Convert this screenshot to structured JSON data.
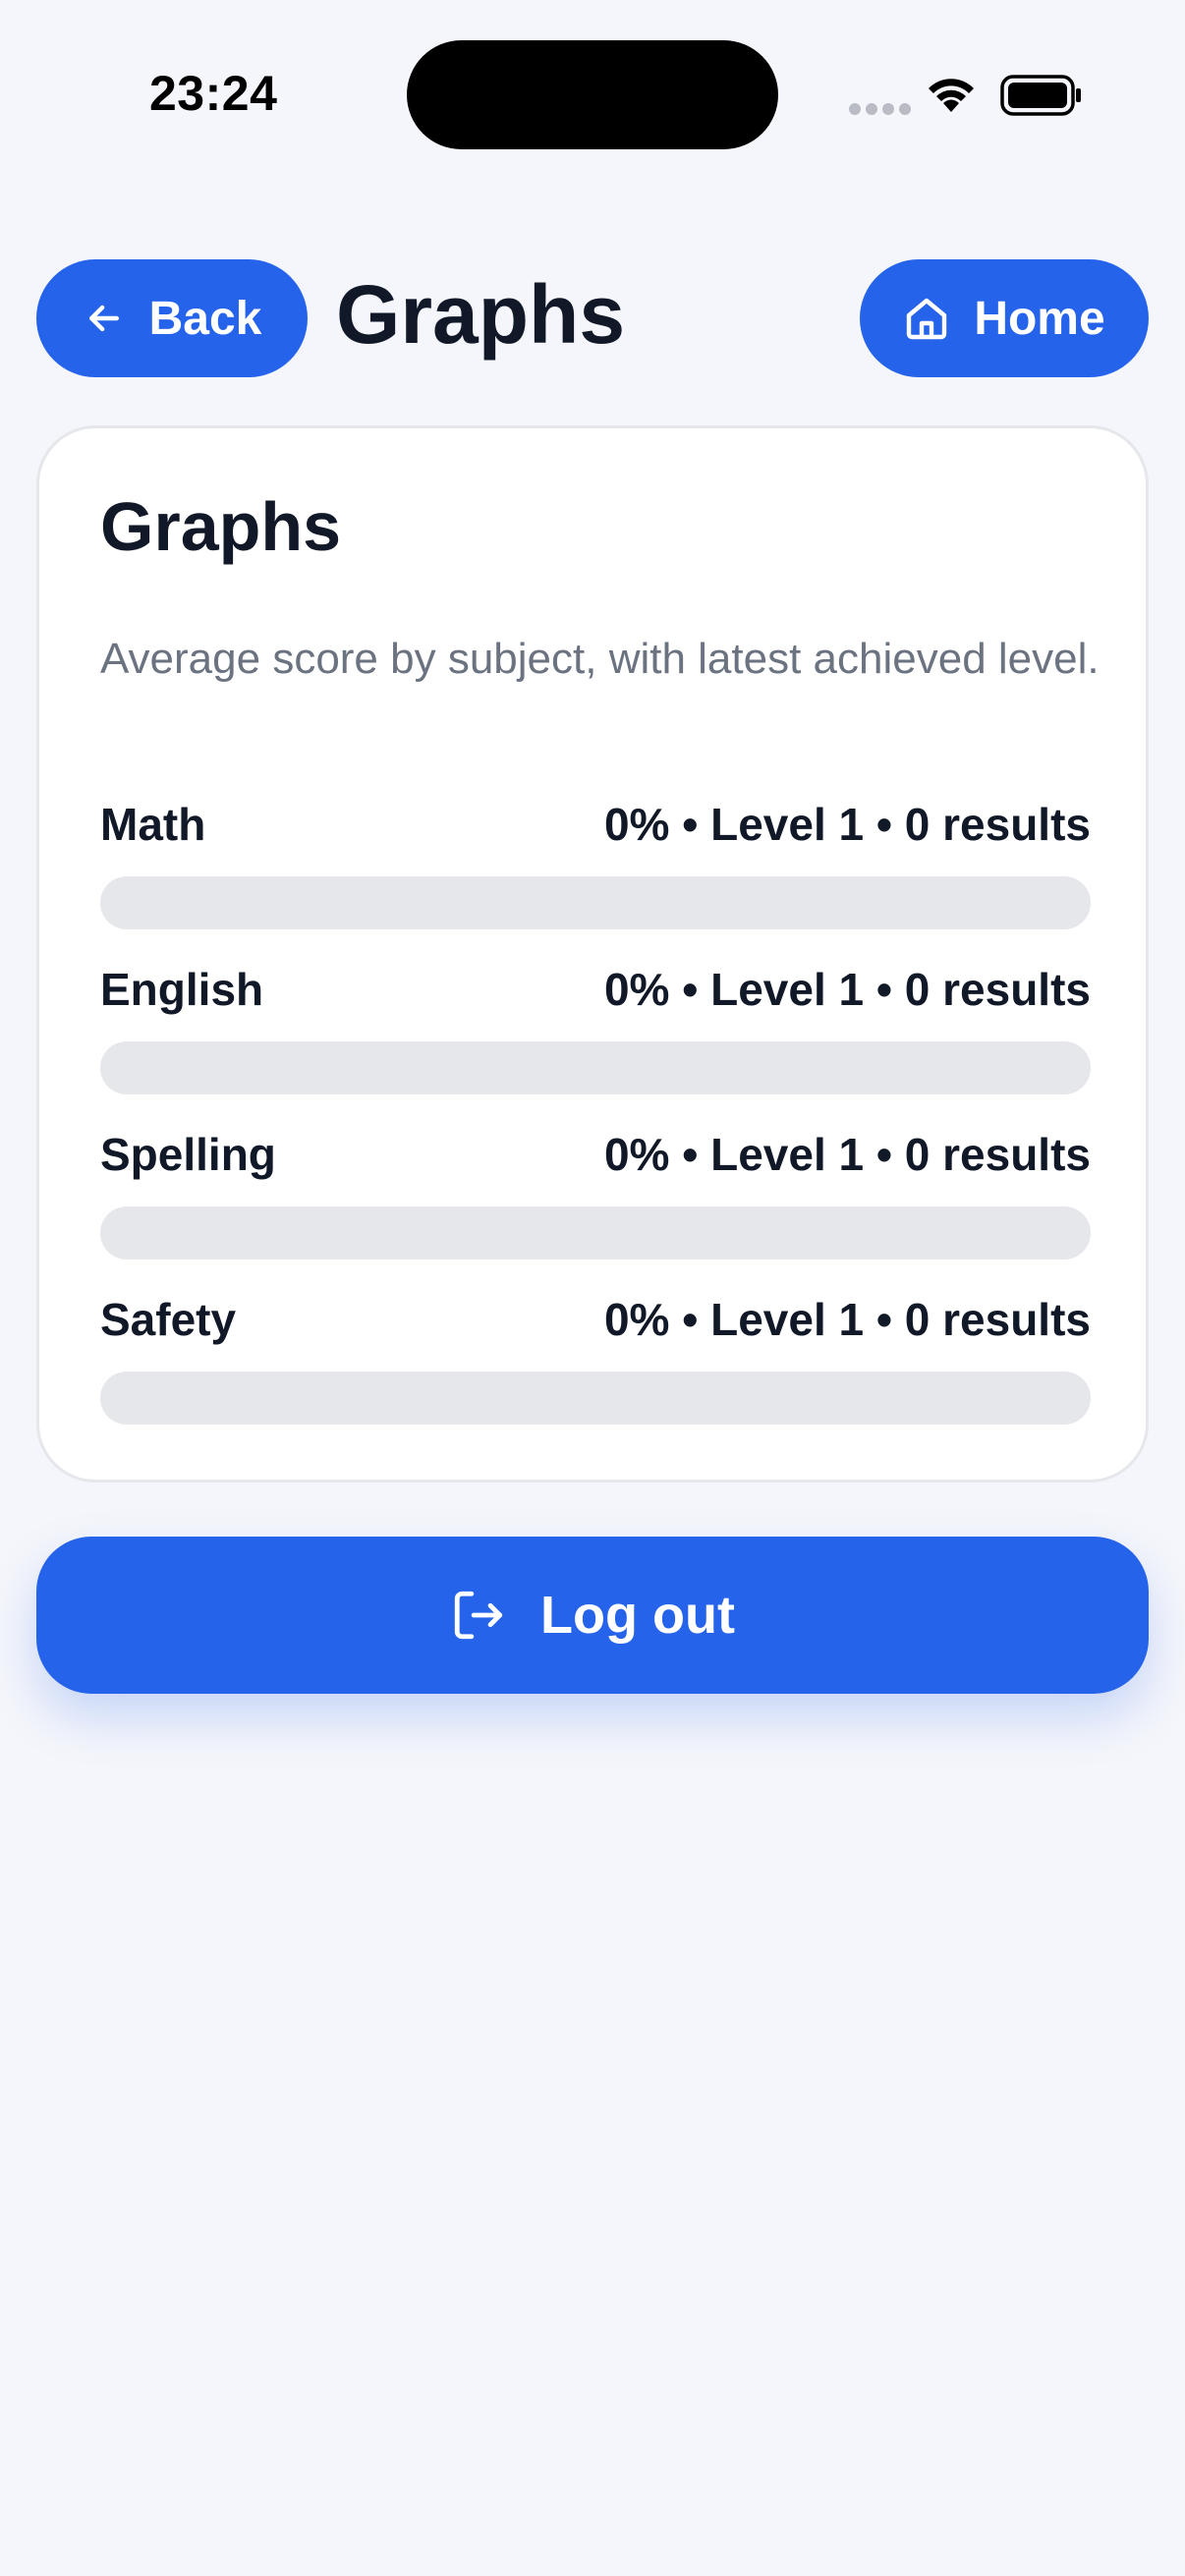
{
  "status_bar": {
    "time": "23:24",
    "icons": [
      "cellular-signal-icon",
      "wifi-icon",
      "battery-icon"
    ]
  },
  "header": {
    "back_label": "Back",
    "title": "Graphs",
    "home_label": "Home",
    "back_icon": "arrow-left-icon",
    "home_icon": "home-icon"
  },
  "card": {
    "title": "Graphs",
    "description": "Average score by subject, with latest achieved level.",
    "subjects": [
      {
        "name": "Math",
        "stats": "0% • Level 1 • 0 results",
        "percent": 0
      },
      {
        "name": "English",
        "stats": "0% • Level 1 • 0 results",
        "percent": 0
      },
      {
        "name": "Spelling",
        "stats": "0% • Level 1 • 0 results",
        "percent": 0
      },
      {
        "name": "Safety",
        "stats": "0% • Level 1 • 0 results",
        "percent": 0
      }
    ]
  },
  "logout": {
    "label": "Log out",
    "icon": "logout-icon"
  },
  "colors": {
    "accent": "#2563eb",
    "background": "#f5f6fb",
    "track": "#e5e7eb",
    "text": "#111827",
    "muted": "#6b7280"
  }
}
